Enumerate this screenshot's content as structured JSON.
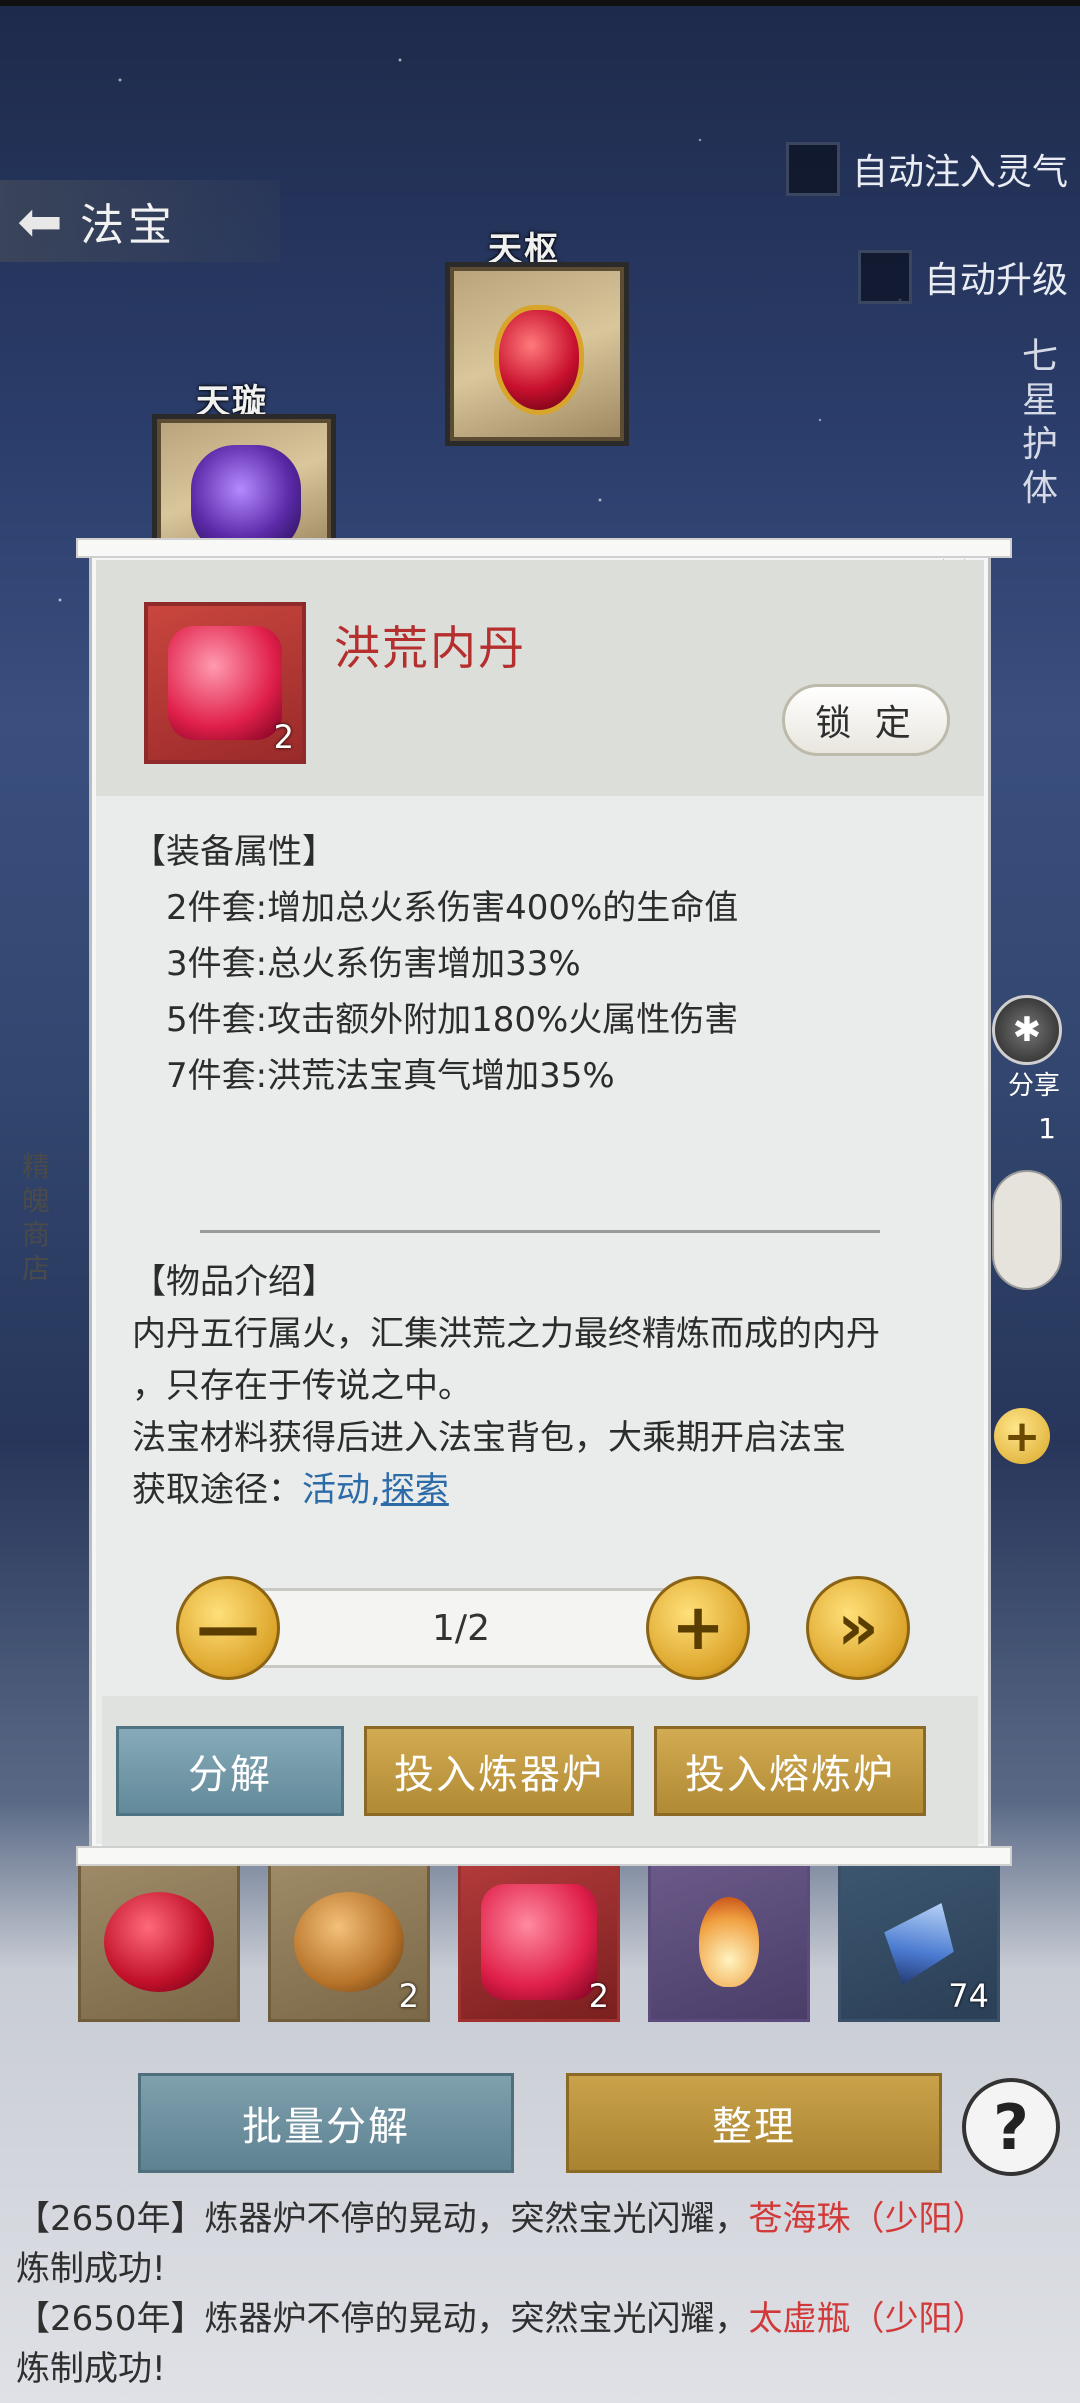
{
  "header": {
    "back_icon": "back-arrow-icon",
    "title": "法宝"
  },
  "options": {
    "auto_inject": "自动注入灵气",
    "auto_upgrade": "自动升级"
  },
  "side_vertical": "七星护体",
  "slots": {
    "tianshu": "天枢",
    "tianxuan": "天璇"
  },
  "side_store": "精魄商店",
  "side_share": "分享",
  "side_count": "1",
  "popup": {
    "item_name": "洪荒内丹",
    "item_count": "2",
    "lock_label": "锁 定",
    "equip_attr_header": "【装备属性】",
    "attrs": [
      "2件套:增加总火系伤害400%的生命值",
      "3件套:总火系伤害增加33%",
      "5件套:攻击额外附加180%火属性伤害",
      "7件套:洪荒法宝真气增加35%"
    ],
    "intro_header": "【物品介绍】",
    "intro_line1": "内丹五行属火，汇集洪荒之力最终精炼而成的内丹",
    "intro_line2": "，只存在于传说之中。",
    "intro_line3": "法宝材料获得后进入法宝背包，大乘期开启法宝",
    "obtain_prefix": "获取途径：",
    "obtain_link1": "活动",
    "obtain_sep": ",",
    "obtain_link2": "探索",
    "stepper_value": "1/2",
    "minus_label": "—",
    "plus_label": "+",
    "max_label": "»",
    "btn_decompose": "分解",
    "btn_forge": "投入炼器炉",
    "btn_smelt": "投入熔炼炉"
  },
  "bag": [
    {
      "count": ""
    },
    {
      "count": "2"
    },
    {
      "count": "2"
    },
    {
      "count": ""
    },
    {
      "count": "74"
    }
  ],
  "buttons": {
    "batch": "批量分解",
    "sort": "整理",
    "help": "?"
  },
  "logs": [
    {
      "prefix": "【2650年】炼器炉不停的晃动，突然宝光闪耀，",
      "item": "苍海珠（少阳）",
      "suffix": "炼制成功!"
    },
    {
      "prefix": "【2650年】炼器炉不停的晃动，突然宝光闪耀，",
      "item": "太虚瓶（少阳）",
      "suffix": "炼制成功!"
    }
  ]
}
